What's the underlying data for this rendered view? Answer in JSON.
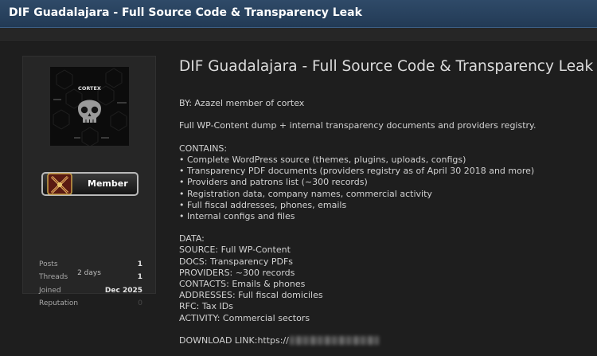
{
  "header": {
    "title": "DIF Guadalajara - Full Source Code & Transparency Leak"
  },
  "user": {
    "avatar_label": "CORTEX",
    "rank": "Member",
    "stats": [
      {
        "label": "Posts",
        "value": "1"
      },
      {
        "label": "Threads",
        "value": "1"
      },
      {
        "label": "Joined",
        "value": "Dec 2025"
      },
      {
        "label": "Reputation",
        "value": "0"
      }
    ],
    "last_seen": "2 days"
  },
  "post": {
    "title": "DIF Guadalajara - Full Source Code & Transparency Leak",
    "author_line": "BY: Azazel member of cortex",
    "summary": "Full WP-Content dump + internal transparency documents and providers registry.",
    "contains_heading": "CONTAINS:",
    "contains": [
      "• Complete WordPress source (themes, plugins, uploads, configs)",
      "• Transparency PDF documents (providers registry as of April 30 2018 and more)",
      "• Providers and patrons list (~300 records)",
      "• Registration data, company names, commercial activity",
      "• Full fiscal addresses, phones, emails",
      "• Internal configs and files"
    ],
    "data_heading": "DATA:",
    "data": [
      "SOURCE: Full WP-Content",
      "DOCS: Transparency PDFs",
      "PROVIDERS: ~300 records",
      "CONTACTS: Emails & phones",
      "ADDRESSES: Full fiscal domiciles",
      "RFC: Tax IDs",
      "ACTIVITY: Commercial sectors"
    ],
    "download_label": "DOWNLOAD LINK:https://"
  },
  "colors": {
    "header_bg": "#223a55",
    "page_bg": "#1e1e1e",
    "panel_bg": "#262626",
    "text": "#d2d2d2"
  }
}
